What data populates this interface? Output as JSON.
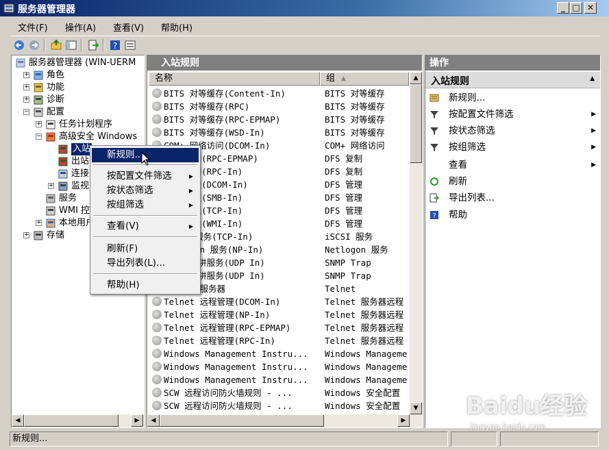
{
  "window": {
    "title": "服务器管理器"
  },
  "menubar": [
    "文件(F)",
    "操作(A)",
    "查看(V)",
    "帮助(H)"
  ],
  "tree": {
    "items": [
      {
        "label": "服务器管理器 (WIN-UERM",
        "icon": "server-icon",
        "level": 0,
        "expander": ""
      },
      {
        "label": "角色",
        "icon": "roles-icon",
        "level": 1,
        "expander": "+"
      },
      {
        "label": "功能",
        "icon": "features-icon",
        "level": 1,
        "expander": "+"
      },
      {
        "label": "诊断",
        "icon": "diagnostics-icon",
        "level": 1,
        "expander": "+"
      },
      {
        "label": "配置",
        "icon": "configuration-icon",
        "level": 1,
        "expander": "-"
      },
      {
        "label": "任务计划程序",
        "icon": "clock-icon",
        "level": 2,
        "expander": "+"
      },
      {
        "label": "高级安全 Windows",
        "icon": "firewall-icon",
        "level": 2,
        "expander": "-"
      },
      {
        "label": "入站",
        "icon": "inbound-rules-icon",
        "level": 3,
        "expander": ""
      },
      {
        "label": "出站",
        "icon": "outbound-rules-icon",
        "level": 3,
        "expander": ""
      },
      {
        "label": "连接",
        "icon": "connection-security-icon",
        "level": 3,
        "expander": ""
      },
      {
        "label": "监视",
        "icon": "monitor-icon",
        "level": 3,
        "expander": "+"
      },
      {
        "label": "服务",
        "icon": "services-icon",
        "level": 2,
        "expander": ""
      },
      {
        "label": "WMI 控",
        "icon": "wmi-icon",
        "level": 2,
        "expander": ""
      },
      {
        "label": "本地用户",
        "icon": "users-icon",
        "level": 2,
        "expander": "+"
      },
      {
        "label": "存储",
        "icon": "storage-icon",
        "level": 1,
        "expander": "+"
      }
    ]
  },
  "list": {
    "header": "入站规则",
    "col_name": "名称",
    "col_group": "组",
    "rows": [
      {
        "name": "BITS 对等缓存(Content-In)",
        "group": "BITS 对等缓存"
      },
      {
        "name": "BITS 对等缓存(RPC)",
        "group": "BITS 对等缓存"
      },
      {
        "name": "BITS 对等缓存(RPC-EPMAP)",
        "group": "BITS 对等缓存"
      },
      {
        "name": "BITS 对等缓存(WSD-In)",
        "group": "BITS 对等缓存"
      },
      {
        "name": "COM+ 网络访问(DCOM-In)",
        "group": "COM+ 网络访问"
      },
      {
        "name": "DFS 复制(RPC-EPMAP)",
        "group": "DFS 复制"
      },
      {
        "name": "DFS 复制(RPC-In)",
        "group": "DFS 复制"
      },
      {
        "name": "DFS 管理(DCOM-In)",
        "group": "DFS 管理"
      },
      {
        "name": "DFS 管理(SMB-In)",
        "group": "DFS 管理"
      },
      {
        "name": "DFS 管理(TCP-In)",
        "group": "DFS 管理"
      },
      {
        "name": "DFS 管理(WMI-In)",
        "group": "DFS 管理"
      },
      {
        "name": "iSCSI 服务(TCP-In)",
        "group": "iSCSI 服务"
      },
      {
        "name": "Netlogon 服务(NP-In)",
        "group": "Netlogon 服务"
      },
      {
        "name": "SNMP 陷阱服务(UDP In)",
        "group": "SNMP Trap"
      },
      {
        "name": "SNMP 陷阱服务(UDP In)",
        "group": "SNMP Trap"
      },
      {
        "name": "Telnet 服务器",
        "group": "Telnet"
      },
      {
        "name": "Telnet 远程管理(DCOM-In)",
        "group": "Telnet 服务器远程"
      },
      {
        "name": "Telnet 远程管理(NP-In)",
        "group": "Telnet 服务器远程"
      },
      {
        "name": "Telnet 远程管理(RPC-EPMAP)",
        "group": "Telnet 服务器远程"
      },
      {
        "name": "Telnet 远程管理(RPC-In)",
        "group": "Telnet 服务器远程"
      },
      {
        "name": "Windows Management Instru...",
        "group": "Windows Manageme"
      },
      {
        "name": "Windows Management Instru...",
        "group": "Windows Manageme"
      },
      {
        "name": "Windows Management Instru...",
        "group": "Windows Manageme"
      },
      {
        "name": "SCW 远程访问防火墙规则 - ...",
        "group": "Windows 安全配置"
      },
      {
        "name": "SCW 远程访问防火墙规则 - ...",
        "group": "Windows 安全配置"
      }
    ]
  },
  "actions": {
    "header": "操作",
    "section": "入站规则",
    "items": [
      {
        "label": "新规则...",
        "icon": "new-rule-icon",
        "submenu": false
      },
      {
        "label": "按配置文件筛选",
        "icon": "filter-icon",
        "submenu": true
      },
      {
        "label": "按状态筛选",
        "icon": "filter-icon",
        "submenu": true
      },
      {
        "label": "按组筛选",
        "icon": "filter-icon",
        "submenu": true
      },
      {
        "label": "查看",
        "icon": "",
        "submenu": true
      },
      {
        "label": "刷新",
        "icon": "refresh-icon",
        "submenu": false
      },
      {
        "label": "导出列表...",
        "icon": "export-icon",
        "submenu": false
      },
      {
        "label": "帮助",
        "icon": "help-icon",
        "submenu": false
      }
    ]
  },
  "context_menu": {
    "items": [
      {
        "label": "新规则...",
        "selected": true,
        "submenu": false
      },
      {
        "label": "按配置文件筛选",
        "submenu": true
      },
      {
        "label": "按状态筛选",
        "submenu": true
      },
      {
        "label": "按组筛选",
        "submenu": true
      },
      {
        "label": "查看(V)",
        "submenu": true
      },
      {
        "label": "刷新(F)",
        "submenu": false
      },
      {
        "label": "导出列表(L)...",
        "submenu": false
      },
      {
        "label": "帮助(H)",
        "submenu": false
      }
    ]
  },
  "statusbar": {
    "text": "新规则..."
  },
  "watermark": {
    "logo": "Baidu经验",
    "url": "jingyan.baidu.com"
  },
  "colors": {
    "titlebar": "#0a246a",
    "selection": "#0a246a",
    "pane_header": "#808080"
  }
}
